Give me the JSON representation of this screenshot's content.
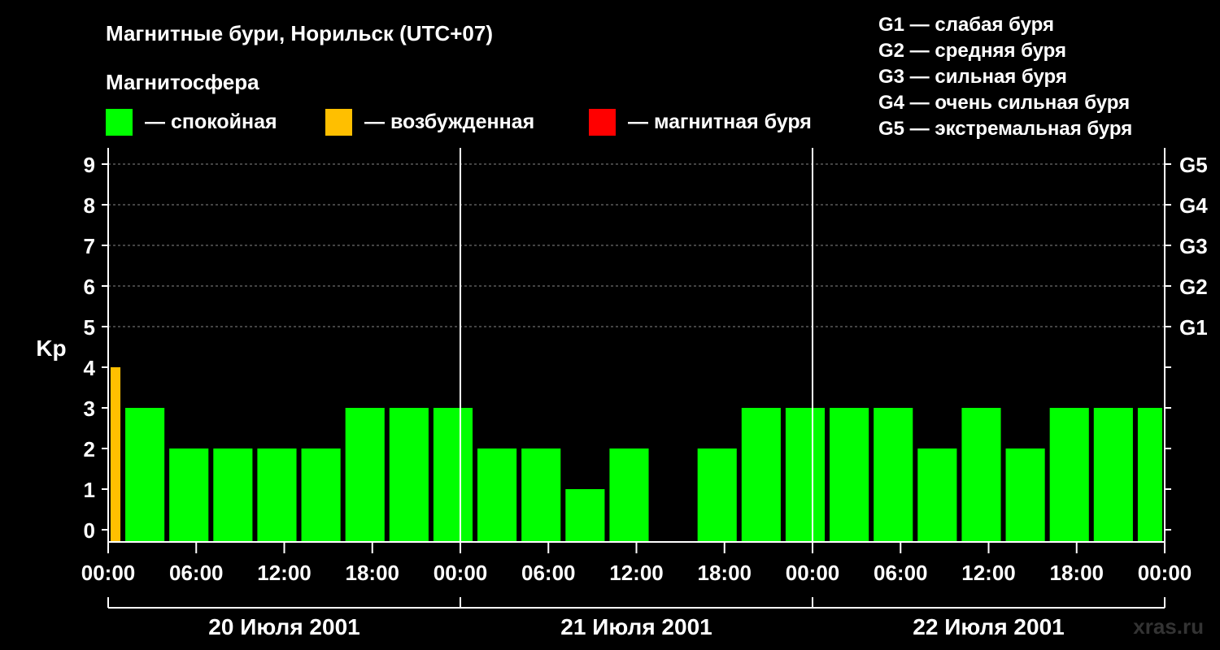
{
  "title": "Магнитные бури, Норильск (UTC+07)",
  "legend": {
    "heading": "Магнитосфера",
    "items": [
      {
        "label": "— спокойная",
        "color": "#00ff00"
      },
      {
        "label": "— возбужденная",
        "color": "#ffbf00"
      },
      {
        "label": "— магнитная буря",
        "color": "#ff0000"
      }
    ]
  },
  "g_scale": [
    "G1 — слабая буря",
    "G2 — средняя буря",
    "G3 — сильная буря",
    "G4 — очень сильная буря",
    "G5 — экстремальная буря"
  ],
  "watermark": "xras.ru",
  "chart_data": {
    "type": "bar",
    "ylabel": "Kp",
    "ylim": [
      0,
      9
    ],
    "yticks": [
      "0",
      "1",
      "2",
      "3",
      "4",
      "5",
      "6",
      "7",
      "8",
      "9"
    ],
    "right_axis_labels": [
      {
        "label": "G1",
        "kp": 5
      },
      {
        "label": "G2",
        "kp": 6
      },
      {
        "label": "G3",
        "kp": 7
      },
      {
        "label": "G4",
        "kp": 8
      },
      {
        "label": "G5",
        "kp": 9
      }
    ],
    "grid": "horizontal dashed at Kp 5-9",
    "x_range_hours": [
      0,
      72
    ],
    "x_tick_labels": [
      "00:00",
      "06:00",
      "12:00",
      "18:00",
      "00:00",
      "06:00",
      "12:00",
      "18:00",
      "00:00",
      "06:00",
      "12:00",
      "18:00",
      "00:00"
    ],
    "days": [
      "20 Июля 2001",
      "21 Июля 2001",
      "22 Июля 2001"
    ],
    "bars": [
      {
        "start": 0,
        "end": 1,
        "kp": 4,
        "level": "excited",
        "color": "#ffbf00"
      },
      {
        "start": 1,
        "end": 4,
        "kp": 3,
        "level": "quiet",
        "color": "#00ff00"
      },
      {
        "start": 4,
        "end": 7,
        "kp": 2,
        "level": "quiet",
        "color": "#00ff00"
      },
      {
        "start": 7,
        "end": 10,
        "kp": 2,
        "level": "quiet",
        "color": "#00ff00"
      },
      {
        "start": 10,
        "end": 13,
        "kp": 2,
        "level": "quiet",
        "color": "#00ff00"
      },
      {
        "start": 13,
        "end": 16,
        "kp": 2,
        "level": "quiet",
        "color": "#00ff00"
      },
      {
        "start": 16,
        "end": 19,
        "kp": 3,
        "level": "quiet",
        "color": "#00ff00"
      },
      {
        "start": 19,
        "end": 22,
        "kp": 3,
        "level": "quiet",
        "color": "#00ff00"
      },
      {
        "start": 22,
        "end": 25,
        "kp": 3,
        "level": "quiet",
        "color": "#00ff00"
      },
      {
        "start": 25,
        "end": 28,
        "kp": 2,
        "level": "quiet",
        "color": "#00ff00"
      },
      {
        "start": 28,
        "end": 31,
        "kp": 2,
        "level": "quiet",
        "color": "#00ff00"
      },
      {
        "start": 31,
        "end": 34,
        "kp": 1,
        "level": "quiet",
        "color": "#00ff00"
      },
      {
        "start": 34,
        "end": 37,
        "kp": 2,
        "level": "quiet",
        "color": "#00ff00"
      },
      {
        "start": 37,
        "end": 40,
        "kp": 0,
        "level": "quiet",
        "color": "#00ff00"
      },
      {
        "start": 40,
        "end": 43,
        "kp": 2,
        "level": "quiet",
        "color": "#00ff00"
      },
      {
        "start": 43,
        "end": 46,
        "kp": 3,
        "level": "quiet",
        "color": "#00ff00"
      },
      {
        "start": 46,
        "end": 49,
        "kp": 3,
        "level": "quiet",
        "color": "#00ff00"
      },
      {
        "start": 49,
        "end": 52,
        "kp": 3,
        "level": "quiet",
        "color": "#00ff00"
      },
      {
        "start": 52,
        "end": 55,
        "kp": 3,
        "level": "quiet",
        "color": "#00ff00"
      },
      {
        "start": 55,
        "end": 58,
        "kp": 2,
        "level": "quiet",
        "color": "#00ff00"
      },
      {
        "start": 58,
        "end": 61,
        "kp": 3,
        "level": "quiet",
        "color": "#00ff00"
      },
      {
        "start": 61,
        "end": 64,
        "kp": 2,
        "level": "quiet",
        "color": "#00ff00"
      },
      {
        "start": 64,
        "end": 67,
        "kp": 3,
        "level": "quiet",
        "color": "#00ff00"
      },
      {
        "start": 67,
        "end": 70,
        "kp": 3,
        "level": "quiet",
        "color": "#00ff00"
      },
      {
        "start": 70,
        "end": 72,
        "kp": 3,
        "level": "quiet",
        "color": "#00ff00"
      }
    ]
  }
}
